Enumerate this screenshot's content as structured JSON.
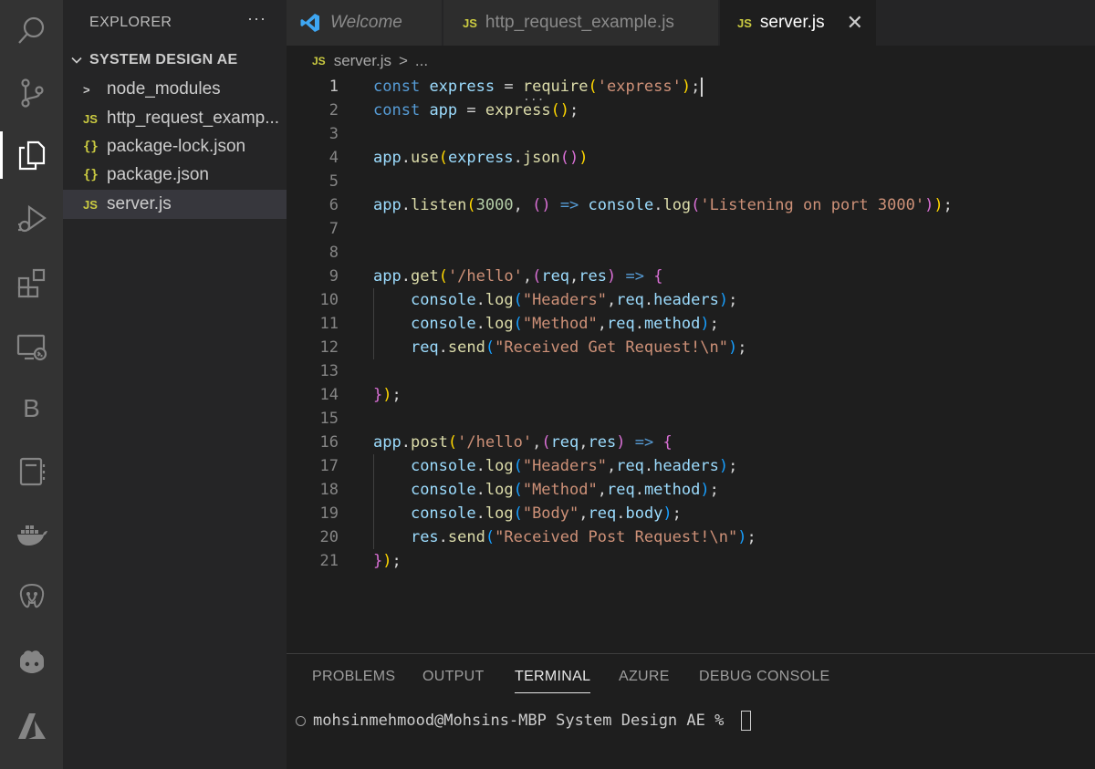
{
  "activity_bar": {
    "items": [
      {
        "icon": "search-icon"
      },
      {
        "icon": "source-control-icon"
      },
      {
        "icon": "explorer-icon",
        "active": true
      },
      {
        "icon": "run-debug-icon"
      },
      {
        "icon": "extensions-icon"
      },
      {
        "icon": "remote-explorer-icon"
      },
      {
        "icon": "b-extension-icon",
        "text": "B"
      },
      {
        "icon": "notebook-icon"
      },
      {
        "icon": "docker-icon"
      },
      {
        "icon": "postgres-icon"
      },
      {
        "icon": "copilot-icon"
      },
      {
        "icon": "azure-icon"
      }
    ]
  },
  "sidebar": {
    "title": "EXPLORER",
    "more": "···",
    "folder": "SYSTEM DESIGN AE",
    "items": [
      {
        "icon": ">",
        "label": "node_modules"
      },
      {
        "icon": "JS",
        "label": "http_request_examp..."
      },
      {
        "icon": "{}",
        "label": "package-lock.json"
      },
      {
        "icon": "{}",
        "label": "package.json"
      },
      {
        "icon": "JS",
        "label": "server.js",
        "selected": true
      }
    ]
  },
  "tabs": [
    {
      "label": "Welcome"
    },
    {
      "icon": "JS",
      "label": "http_request_example.js"
    },
    {
      "icon": "JS",
      "label": "server.js",
      "active": true,
      "close": "✕"
    }
  ],
  "breadcrumb": {
    "icon": "JS",
    "file": "server.js",
    "sep": ">",
    "rest": "..."
  },
  "editor": {
    "line_numbers": [
      "1",
      "2",
      "3",
      "4",
      "5",
      "6",
      "7",
      "8",
      "9",
      "10",
      "11",
      "12",
      "13",
      "14",
      "15",
      "16",
      "17",
      "18",
      "19",
      "20",
      "21"
    ],
    "hover_dots": "..."
  },
  "panel": {
    "tabs": [
      "PROBLEMS",
      "OUTPUT",
      "TERMINAL",
      "AZURE",
      "DEBUG CONSOLE"
    ],
    "active_tab": "TERMINAL",
    "prompt": "mohsinmehmood@Mohsins-MBP System Design AE % "
  },
  "colors": {
    "keyword": "#569cd6",
    "variable": "#9cdcfe",
    "function": "#dcdcaa",
    "string": "#ce9178",
    "number": "#b5cea8",
    "js_badge": "#cbcb41",
    "vscode_blue": "#3ea6f2"
  }
}
